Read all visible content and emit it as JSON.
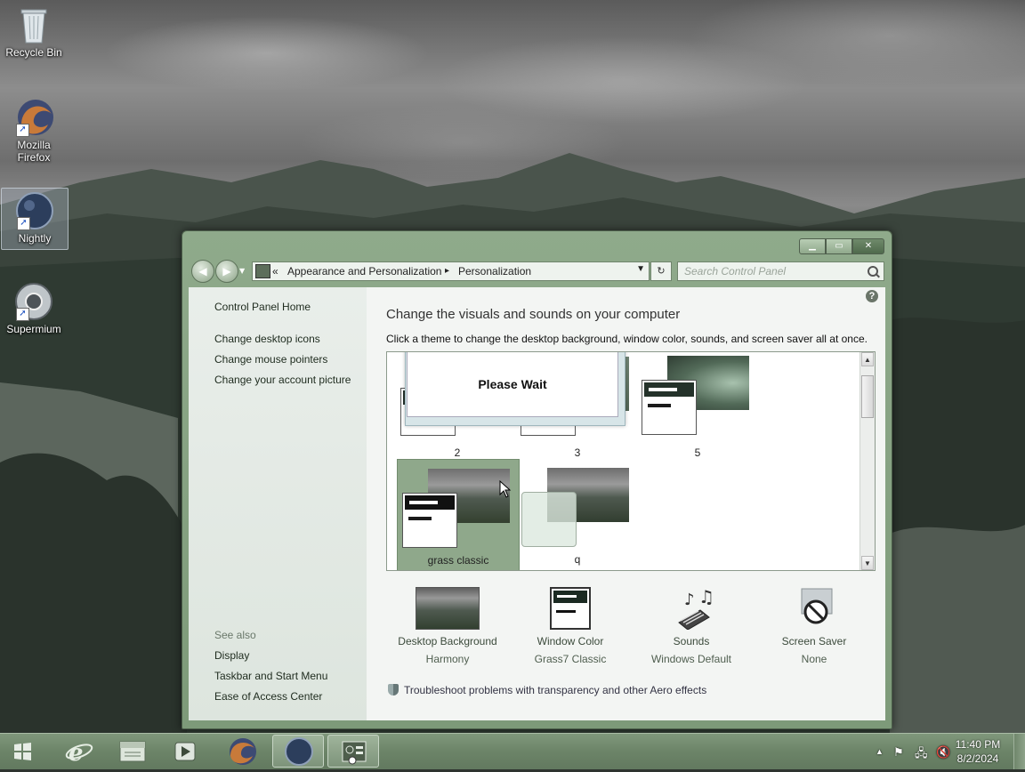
{
  "desktop": {
    "icons": [
      {
        "label": "Recycle Bin"
      },
      {
        "label": "Mozilla Firefox"
      },
      {
        "label": "Nightly"
      },
      {
        "label": "Supermium"
      }
    ]
  },
  "window": {
    "breadcrumb": {
      "chevron": "«",
      "items": [
        "Appearance and Personalization",
        "Personalization"
      ],
      "separator": "▸"
    },
    "search_placeholder": "Search Control Panel",
    "buttons": {
      "minimize": "▁",
      "maximize": "▭",
      "close": "✕"
    },
    "sidebar": {
      "home": "Control Panel Home",
      "links": [
        "Change desktop icons",
        "Change mouse pointers",
        "Change your account picture"
      ],
      "see_also_label": "See also",
      "see_also": [
        "Display",
        "Taskbar and Start Menu",
        "Ease of Access Center"
      ]
    },
    "main": {
      "title": "Change the visuals and sounds on your computer",
      "subtitle": "Click a theme to change the desktop background, window color, sounds, and screen saver all at once.",
      "themes": [
        {
          "label": "2"
        },
        {
          "label": "3"
        },
        {
          "label": "5"
        },
        {
          "label": "grass classic",
          "selected": true
        },
        {
          "label": "q"
        }
      ],
      "please_wait": "Please Wait",
      "bottom_items": [
        {
          "title": "Desktop Background",
          "value": "Harmony",
          "icon": "desktop-background-icon"
        },
        {
          "title": "Window Color",
          "value": "Grass7 Classic",
          "icon": "window-color-icon"
        },
        {
          "title": "Sounds",
          "value": "Windows Default",
          "icon": "sounds-icon"
        },
        {
          "title": "Screen Saver",
          "value": "None",
          "icon": "screen-saver-icon"
        }
      ],
      "troubleshoot": "Troubleshoot problems with transparency and other Aero effects"
    }
  },
  "taskbar": {
    "time": "11:40 PM",
    "date": "8/2/2024"
  },
  "colors": {
    "accent": "#7d9a79",
    "selected_theme": "#8fa88b",
    "taskbar": "#6c8468"
  }
}
